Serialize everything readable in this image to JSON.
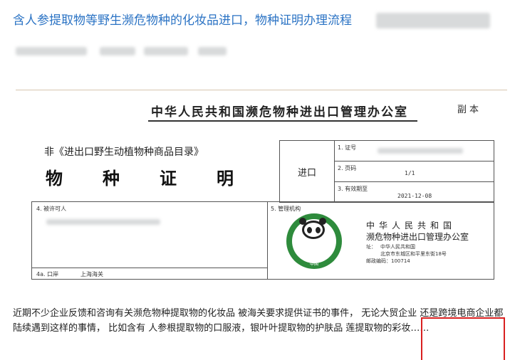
{
  "article": {
    "title": "含人参提取物等野生濒危物种的化妆品进口，物种证明办理流程"
  },
  "certificate": {
    "office_title": "中华人民共和国濒危物种进出口管理办公室",
    "copy_label": "副本",
    "catalog_line": "非《进出口野生动植物种商品目录》",
    "cert_name": "物种证明",
    "direction": "进口",
    "field1_label": "1. 证号",
    "field2_label": "2. 页码",
    "field2_value": "1/1",
    "field3_label": "3. 有效期至",
    "field3_value": "2021-12-08",
    "field4_label": "4. 被许可人",
    "field4a_label": "4a. 口岸",
    "field4a_value": "上海海关",
    "field5_label": "5. 管理机构",
    "logo_text": "CITES",
    "logo_cn": "中国",
    "org_line1": "中华人民共和国",
    "org_line2": "濒危物种进出口管理办公室",
    "org_address_label": "址：",
    "org_address1": "中华人民共和国",
    "org_address2": "北京市东城区和平里东街18号",
    "org_postcode": "邮政编码：100714"
  },
  "body": {
    "paragraph": "近期不少企业反馈和咨询有关濒危物种提取物的化妆品 被海关要求提供证书的事件， 无论大贸企业 还是跨境电商企业都陆续遇到这样的事情， 比如含有 人参根提取物的口服液，银叶叶提取物的护肤品 莲提取物的彩妆……"
  }
}
